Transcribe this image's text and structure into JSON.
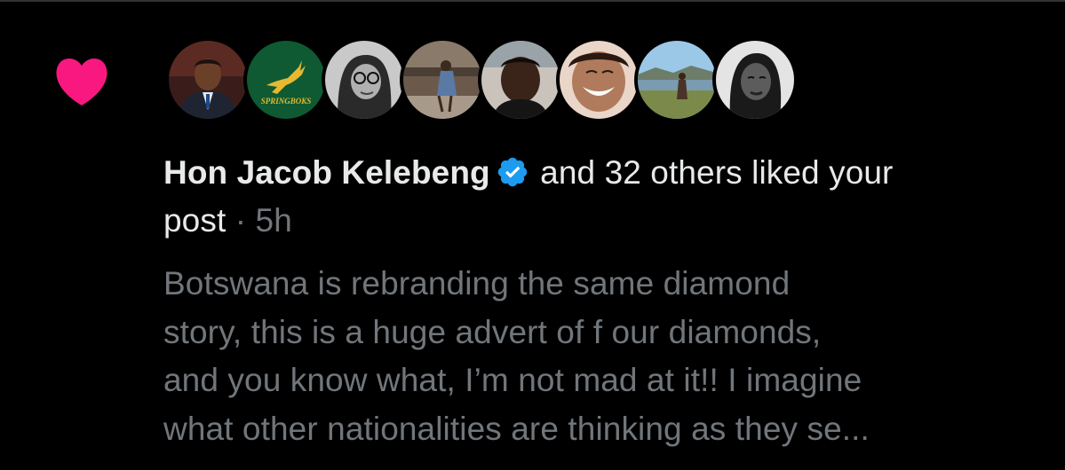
{
  "notification": {
    "type_icon": "heart-icon",
    "accent_color": "#f91880",
    "verified_color": "#1d9bf0",
    "author": "Hon Jacob Kelebeng",
    "action_text": "and 32 others liked your",
    "action_text_2": "post",
    "separator": "·",
    "time": "5h",
    "avatars": [
      {
        "name": "avatar-hon-jacob-kelebeng"
      },
      {
        "name": "avatar-springboks",
        "label": "SPRINGBOKS"
      },
      {
        "name": "avatar-user-3"
      },
      {
        "name": "avatar-user-4"
      },
      {
        "name": "avatar-user-5"
      },
      {
        "name": "avatar-user-6"
      },
      {
        "name": "avatar-user-7"
      },
      {
        "name": "avatar-user-8"
      }
    ],
    "excerpt_lines": [
      "Botswana is rebranding the same diamond",
      "story, this is a huge advert of f our diamonds,",
      "and you know what, I’m not mad at it!! I imagine",
      "what other nationalities are thinking as they se..."
    ]
  }
}
